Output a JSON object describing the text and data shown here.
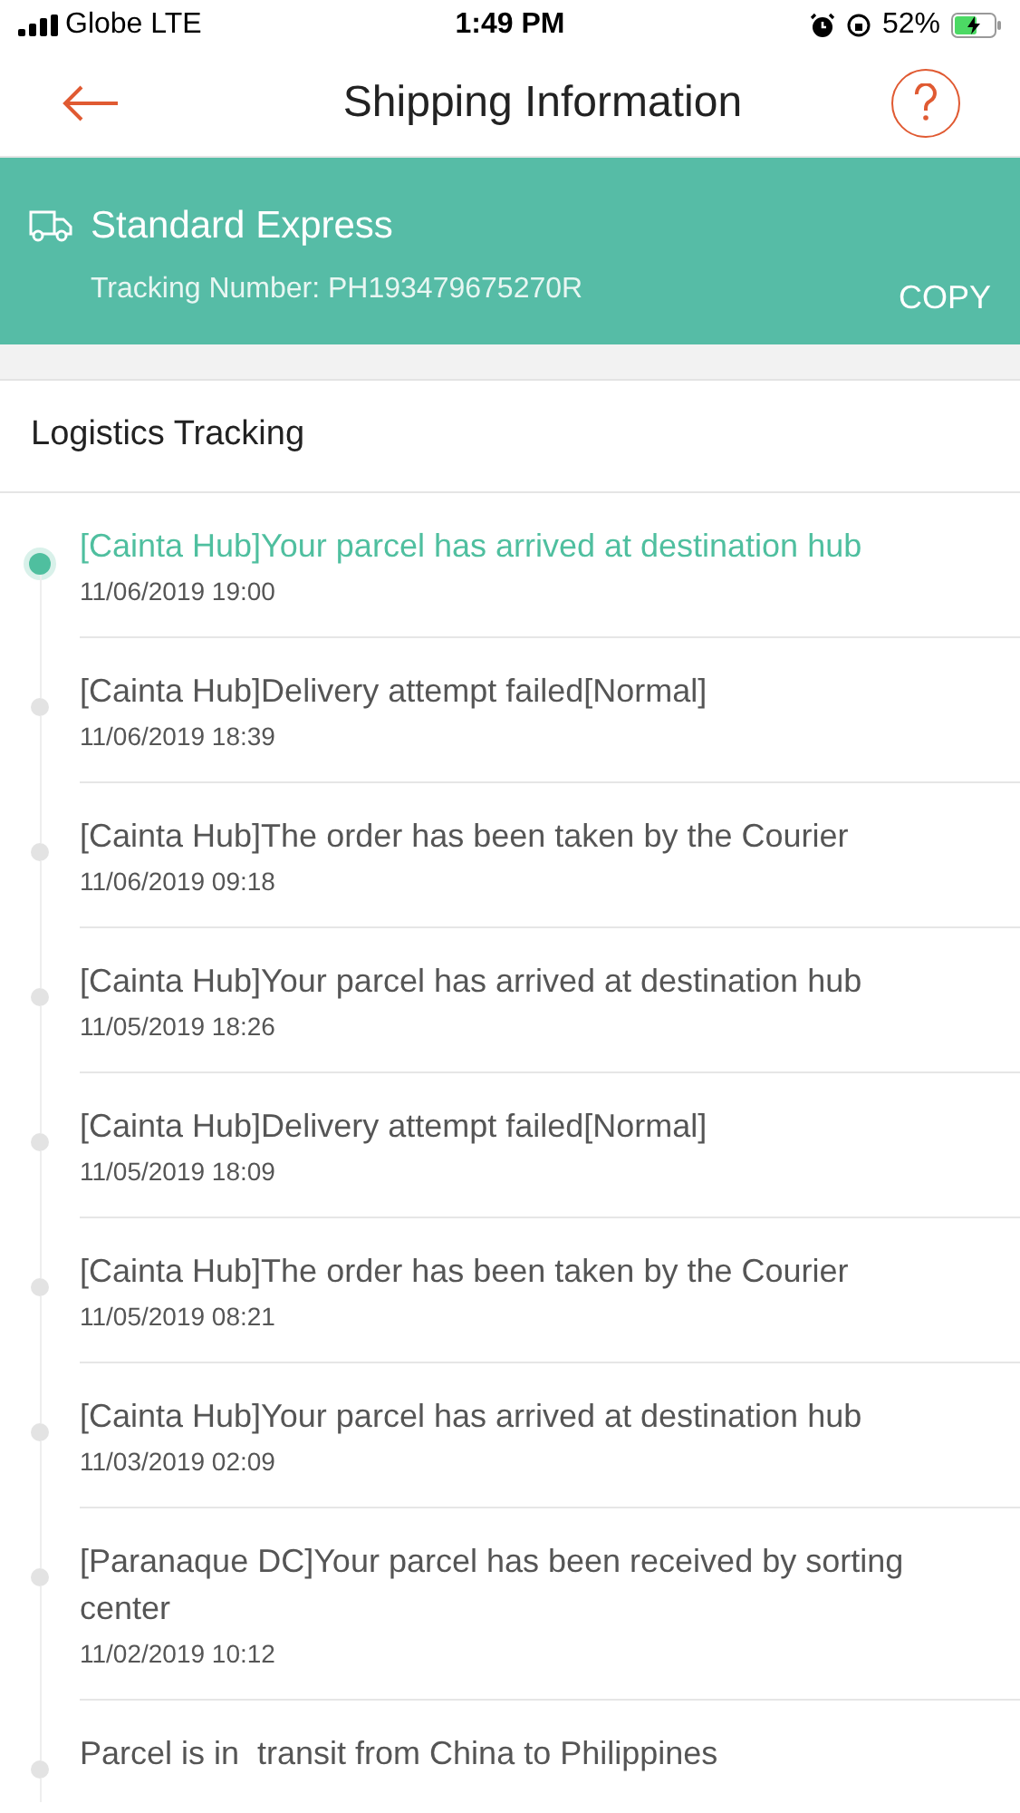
{
  "status_bar": {
    "carrier": "Globe LTE",
    "time": "1:49 PM",
    "battery": "52%"
  },
  "header": {
    "title": "Shipping Information"
  },
  "shipment": {
    "service": "Standard Express",
    "tracking": "Tracking Number: PH193479675270R",
    "copy": "COPY"
  },
  "section_title": "Logistics Tracking",
  "events": [
    {
      "text": "[Cainta Hub]Your parcel has arrived at destination hub",
      "time": "11/06/2019 19:00",
      "selected": true
    },
    {
      "text": "[Cainta Hub]Delivery attempt failed[Normal]",
      "time": "11/06/2019 18:39",
      "selected": false
    },
    {
      "text": "[Cainta Hub]The order has been taken by the Courier",
      "time": "11/06/2019 09:18",
      "selected": false
    },
    {
      "text": "[Cainta Hub]Your parcel has arrived at destination hub",
      "time": "11/05/2019 18:26",
      "selected": false
    },
    {
      "text": "[Cainta Hub]Delivery attempt failed[Normal]",
      "time": "11/05/2019 18:09",
      "selected": false
    },
    {
      "text": "[Cainta Hub]The order has been taken by the Courier",
      "time": "11/05/2019 08:21",
      "selected": false
    },
    {
      "text": "[Cainta Hub]Your parcel has arrived at destination hub",
      "time": "11/03/2019 02:09",
      "selected": false
    },
    {
      "text": "[Paranaque DC]Your parcel has been received by sorting center",
      "time": "11/02/2019 10:12",
      "selected": false
    },
    {
      "text": "Parcel is in  transit from China to Philippines",
      "selected": false
    }
  ]
}
